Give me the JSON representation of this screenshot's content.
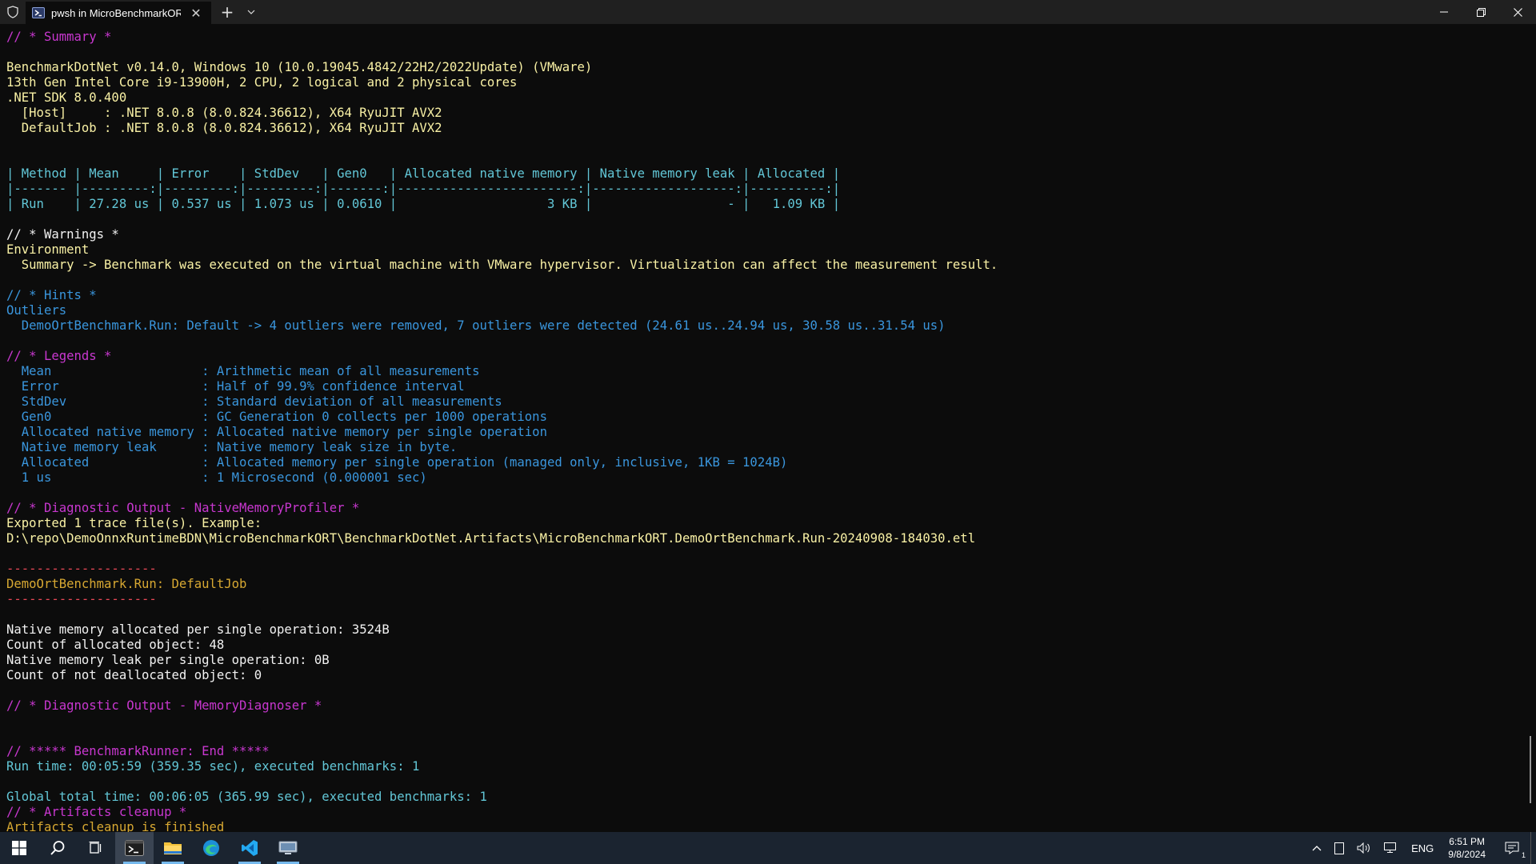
{
  "window": {
    "tab_title": "pwsh in MicroBenchmarkORT",
    "new_tab": "+",
    "close_tab": "✕"
  },
  "colors": {
    "magenta": "#c837cf",
    "yellow": "#f9f1a5",
    "gold": "#d7a832",
    "cyan": "#62c6d6",
    "blue": "#3a96dd",
    "white": "#f2f2f2",
    "red": "#e74856"
  },
  "terminal": {
    "lines": [
      {
        "t": "// * Summary *",
        "c": "magenta"
      },
      {
        "t": "",
        "c": "white"
      },
      {
        "t": "BenchmarkDotNet v0.14.0, Windows 10 (10.0.19045.4842/22H2/2022Update) (VMware)",
        "c": "yellow"
      },
      {
        "t": "13th Gen Intel Core i9-13900H, 2 CPU, 2 logical and 2 physical cores",
        "c": "yellow"
      },
      {
        "t": ".NET SDK 8.0.400",
        "c": "yellow"
      },
      {
        "t": "  [Host]     : .NET 8.0.8 (8.0.824.36612), X64 RyuJIT AVX2",
        "c": "yellow"
      },
      {
        "t": "  DefaultJob : .NET 8.0.8 (8.0.824.36612), X64 RyuJIT AVX2",
        "c": "yellow"
      },
      {
        "t": "",
        "c": "white"
      },
      {
        "t": "",
        "c": "white"
      },
      {
        "t": "| Method | Mean     | Error    | StdDev   | Gen0   | Allocated native memory | Native memory leak | Allocated |",
        "c": "cyan"
      },
      {
        "t": "|------- |---------:|---------:|---------:|-------:|------------------------:|-------------------:|----------:|",
        "c": "cyan"
      },
      {
        "t": "| Run    | 27.28 us | 0.537 us | 1.073 us | 0.0610 |                    3 KB |                  - |   1.09 KB |",
        "c": "cyan"
      },
      {
        "t": "",
        "c": "white"
      },
      {
        "t": "// * Warnings *",
        "c": "white"
      },
      {
        "t": "Environment",
        "c": "yellow"
      },
      {
        "t": "  Summary -> Benchmark was executed on the virtual machine with VMware hypervisor. Virtualization can affect the measurement result.",
        "c": "yellow"
      },
      {
        "t": "",
        "c": "white"
      },
      {
        "t": "// * Hints *",
        "c": "blue"
      },
      {
        "t": "Outliers",
        "c": "blue"
      },
      {
        "t": "  DemoOrtBenchmark.Run: Default -> 4 outliers were removed, 7 outliers were detected (24.61 us..24.94 us, 30.58 us..31.54 us)",
        "c": "blue"
      },
      {
        "t": "",
        "c": "white"
      },
      {
        "t": "// * Legends *",
        "c": "magenta"
      },
      {
        "t": "  Mean                    : Arithmetic mean of all measurements",
        "c": "blue"
      },
      {
        "t": "  Error                   : Half of 99.9% confidence interval",
        "c": "blue"
      },
      {
        "t": "  StdDev                  : Standard deviation of all measurements",
        "c": "blue"
      },
      {
        "t": "  Gen0                    : GC Generation 0 collects per 1000 operations",
        "c": "blue"
      },
      {
        "t": "  Allocated native memory : Allocated native memory per single operation",
        "c": "blue"
      },
      {
        "t": "  Native memory leak      : Native memory leak size in byte.",
        "c": "blue"
      },
      {
        "t": "  Allocated               : Allocated memory per single operation (managed only, inclusive, 1KB = 1024B)",
        "c": "blue"
      },
      {
        "t": "  1 us                    : 1 Microsecond (0.000001 sec)",
        "c": "blue"
      },
      {
        "t": "",
        "c": "white"
      },
      {
        "t": "// * Diagnostic Output - NativeMemoryProfiler *",
        "c": "magenta"
      },
      {
        "t": "Exported 1 trace file(s). Example:",
        "c": "yellow"
      },
      {
        "t": "D:\\repo\\DemoOnnxRuntimeBDN\\MicroBenchmarkORT\\BenchmarkDotNet.Artifacts\\MicroBenchmarkORT.DemoOrtBenchmark.Run-20240908-184030.etl",
        "c": "yellow"
      },
      {
        "t": "",
        "c": "white"
      },
      {
        "t": "--------------------",
        "c": "red"
      },
      {
        "t": "DemoOrtBenchmark.Run: DefaultJob",
        "c": "gold"
      },
      {
        "t": "--------------------",
        "c": "red"
      },
      {
        "t": "",
        "c": "white"
      },
      {
        "t": "Native memory allocated per single operation: 3524B",
        "c": "white"
      },
      {
        "t": "Count of allocated object: 48",
        "c": "white"
      },
      {
        "t": "Native memory leak per single operation: 0B",
        "c": "white"
      },
      {
        "t": "Count of not deallocated object: 0",
        "c": "white"
      },
      {
        "t": "",
        "c": "white"
      },
      {
        "t": "// * Diagnostic Output - MemoryDiagnoser *",
        "c": "magenta"
      },
      {
        "t": "",
        "c": "white"
      },
      {
        "t": "",
        "c": "white"
      },
      {
        "t": "// ***** BenchmarkRunner: End *****",
        "c": "magenta"
      },
      {
        "t": "Run time: 00:05:59 (359.35 sec), executed benchmarks: 1",
        "c": "cyan"
      },
      {
        "t": "",
        "c": "white"
      },
      {
        "t": "Global total time: 00:06:05 (365.99 sec), executed benchmarks: 1",
        "c": "cyan"
      },
      {
        "t": "// * Artifacts cleanup *",
        "c": "magenta"
      },
      {
        "t": "Artifacts cleanup is finished",
        "c": "gold"
      }
    ]
  },
  "taskbar": {
    "apps": [
      {
        "name": "start-button",
        "icon": "windows-icon"
      },
      {
        "name": "search-button",
        "icon": "search-icon"
      },
      {
        "name": "task-view-button",
        "icon": "task-view-icon"
      },
      {
        "name": "terminal-app",
        "icon": "terminal-icon",
        "active": true
      },
      {
        "name": "file-explorer-app",
        "icon": "folder-icon"
      },
      {
        "name": "edge-app",
        "icon": "edge-icon"
      },
      {
        "name": "vscode-app",
        "icon": "vscode-icon"
      },
      {
        "name": "remote-app",
        "icon": "monitor-icon"
      }
    ],
    "tray": {
      "language": "ENG",
      "time": "6:51 PM",
      "date": "9/8/2024",
      "notification_count": "1"
    }
  }
}
